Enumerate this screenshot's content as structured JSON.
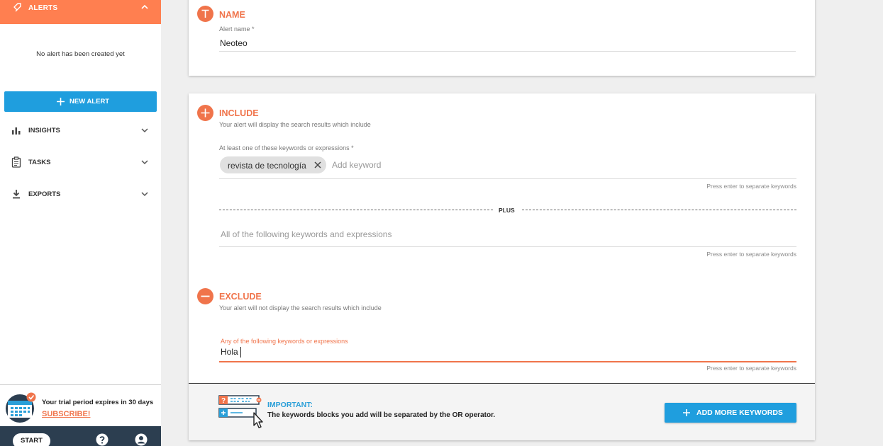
{
  "colors": {
    "accent": "#f0744b",
    "header": "#ff7f50",
    "primary": "#1f9ede",
    "dark": "#2c3e50"
  },
  "sidebar": {
    "alerts_label": "ALERTS",
    "empty_text": "No alert has been created yet",
    "new_alert_label": "NEW ALERT",
    "nav": [
      {
        "label": "INSIGHTS",
        "icon": "bar-chart-icon"
      },
      {
        "label": "TASKS",
        "icon": "clipboard-icon"
      },
      {
        "label": "EXPORTS",
        "icon": "download-icon"
      }
    ],
    "trial_text": "Your trial period expires in 30 days",
    "subscribe_label": "SUBSCRIBE!",
    "start_tour_label": "START TOUR"
  },
  "name_section": {
    "title": "NAME",
    "field_label": "Alert name *",
    "value": "Neoteo"
  },
  "include_section": {
    "title": "INCLUDE",
    "subtitle": "Your alert will display the search results which include",
    "field_label": "At least one of these keywords or expressions *",
    "chips": [
      "revista de tecnología"
    ],
    "placeholder": "Add keyword",
    "hint": "Press enter to separate keywords",
    "plus_label": "PLUS",
    "all_placeholder": "All of the following keywords and expressions",
    "all_hint": "Press enter to separate keywords"
  },
  "exclude_section": {
    "title": "EXCLUDE",
    "subtitle": "Your alert will not display the search results which include",
    "field_label": "Any of the following keywords or expressions",
    "value": "Hola",
    "hint": "Press enter to separate keywords"
  },
  "footer": {
    "important_title": "IMPORTANT:",
    "important_text": "The keywords blocks you add will be separated by the OR operator.",
    "add_more_label": "ADD MORE KEYWORDS"
  }
}
